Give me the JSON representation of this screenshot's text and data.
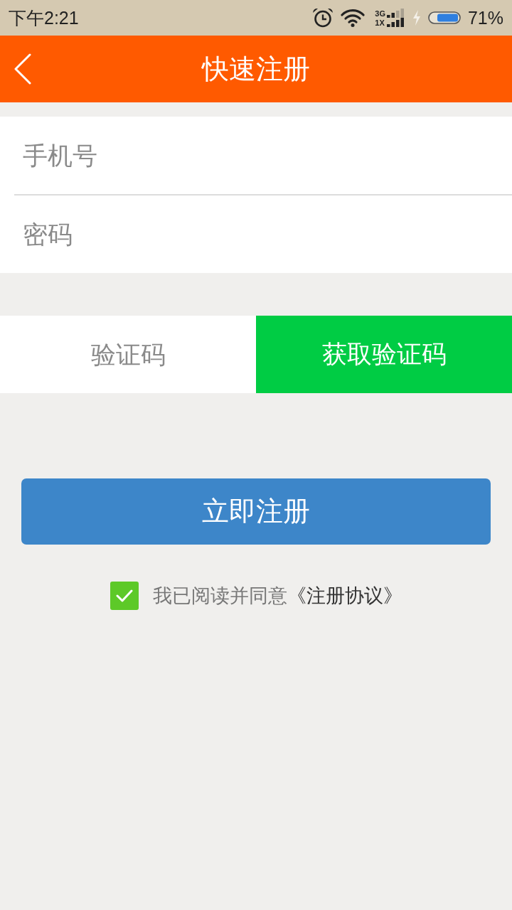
{
  "status_bar": {
    "time": "下午2:21",
    "network_top": "3G",
    "network_bottom": "1X",
    "battery": "71%"
  },
  "header": {
    "title": "快速注册"
  },
  "form": {
    "fields": [
      {
        "placeholder": "手机号"
      },
      {
        "placeholder": "密码"
      }
    ]
  },
  "verification": {
    "placeholder": "验证码",
    "button": "获取验证码"
  },
  "register_button": "立即注册",
  "agreement": {
    "checked": true,
    "text": "我已阅读并同意",
    "link": "《注册协议》"
  }
}
